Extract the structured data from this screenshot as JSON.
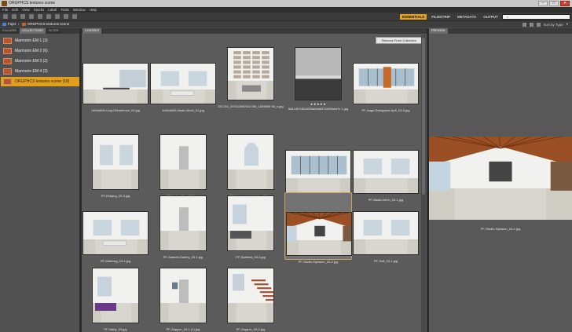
{
  "window": {
    "title": "ORGPHCS textures scene",
    "minimize": "–",
    "maximize": "□",
    "close": "✕"
  },
  "menu": [
    "File",
    "Edit",
    "View",
    "Stacks",
    "Label",
    "Tools",
    "Window",
    "Help"
  ],
  "path": {
    "root": "Fujet",
    "current": "ORGPHCS textures scene"
  },
  "workspaces": [
    {
      "label": "ESSENTIALS",
      "active": true
    },
    {
      "label": "FILMSTRIP",
      "active": false
    },
    {
      "label": "METADATA",
      "active": false
    },
    {
      "label": "OUTPUT",
      "active": false
    }
  ],
  "search": {
    "placeholder": ""
  },
  "sort_label": "Sort by Type",
  "left_tabs": [
    "FOLDERS",
    "COLLECTIONS",
    "FILTER"
  ],
  "collections": [
    {
      "label": "Marmorin EM 1 (3)",
      "selected": false
    },
    {
      "label": "Marmorin EM 2 (6)",
      "selected": false
    },
    {
      "label": "Marmorin EM 3 (2)",
      "selected": false
    },
    {
      "label": "Marmorin EM 4 (3)",
      "selected": false
    },
    {
      "label": "ORGPHCS textures scene (18)",
      "selected": true
    }
  ],
  "content_tab": "CONTENT",
  "preview_tab": "PREVIEW",
  "remove_button": "Remove From Collection",
  "thumbnails": [
    {
      "name": "1460a659-Lloyd-Residence_02.jpg",
      "theme": "dining"
    },
    {
      "name": "1460a660-Mads-Ulrich_01.jpg",
      "theme": "living-white"
    },
    {
      "name": "391734_297513887610780_1639856 98_n.jpg",
      "theme": "shelves"
    },
    {
      "name": "6841d57d51d526a64a6574e05bea7c 1.jpg",
      "theme": "sea",
      "stars": "★★★★★"
    },
    {
      "name": "PF-Aage-Damgaard-Ap5_03-3.jpg",
      "theme": "office"
    },
    {
      "name": "PF-Esbjerg_03-3.jpg",
      "theme": "window-room"
    },
    {
      "name": "PF-Hafen-City_03-3.jpg",
      "theme": "doorway"
    },
    {
      "name": "PF-Holgaard-Arkitekter_03.jpg",
      "theme": "arch"
    },
    {
      "name": "PF-Isb_03.jpg",
      "theme": "panorama"
    },
    {
      "name": "PF-Mads-Ulrich_03-1.jpg",
      "theme": "empty"
    },
    {
      "name": "PF-Maleveg_03-1.jpg",
      "theme": "living-white"
    },
    {
      "name": "PF-Saatchi-Gallery_03-1.jpg",
      "theme": "gallery"
    },
    {
      "name": "PF-Spallard_03-4.jpg",
      "theme": "sofa"
    },
    {
      "name": "PF-Studio-Nyhamn_03-2.jpg",
      "theme": "wood-roof",
      "selected": true
    },
    {
      "name": "PF-Soft_03-1.jpg",
      "theme": "bright"
    },
    {
      "name": "PF-Valby_03.jpg",
      "theme": "purple-sofa"
    },
    {
      "name": "PF-Zappon_03-1 (1).jpg",
      "theme": "wall-art"
    },
    {
      "name": "PF-Zappon_03-2.jpg",
      "theme": "stair"
    }
  ],
  "preview": {
    "name": "PF-Studio-Nyhamn_03-2.jpg"
  }
}
